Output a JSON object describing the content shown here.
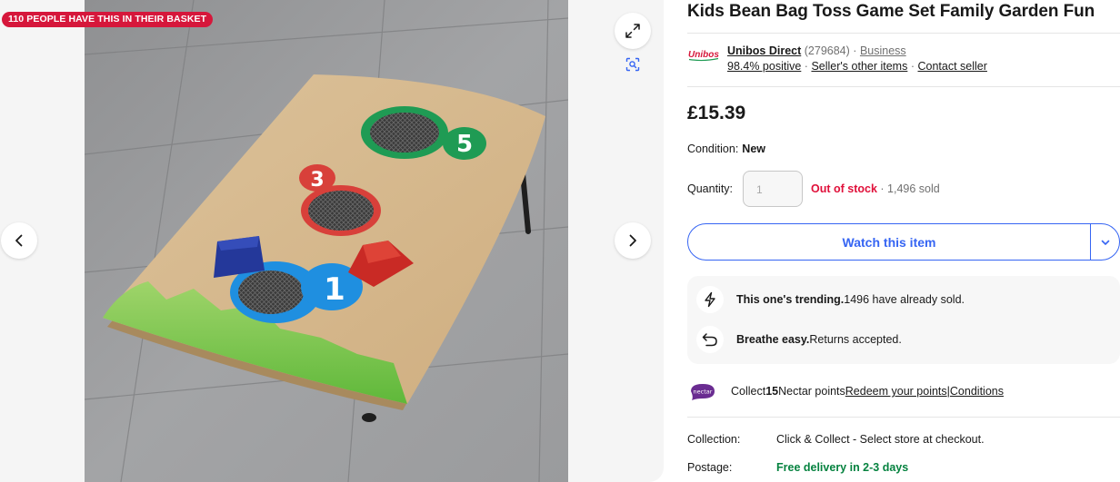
{
  "badge": "110 PEOPLE HAVE THIS IN THEIR BASKET",
  "icons": {
    "prev": "chevron-left-icon",
    "next": "chevron-right-icon",
    "expand": "expand-icon",
    "scan": "visual-search-icon",
    "dropdown": "chevron-down-icon",
    "trending": "lightning-icon",
    "returns": "return-arrow-icon"
  },
  "product": {
    "title": "Kids Bean Bag Toss Game Set Family Garden Fun",
    "price": "£15.39"
  },
  "seller": {
    "logo_text": "Unibos",
    "name": "Unibos Direct",
    "feedback_count": "(279684)",
    "sep1": "·",
    "type": "Business",
    "positive": "98.4% positive",
    "sep2": "·",
    "other_items": "Seller's other items",
    "sep3": "·",
    "contact": "Contact seller"
  },
  "condition": {
    "label": "Condition:",
    "value": "New"
  },
  "quantity": {
    "label": "Quantity:",
    "value": "1",
    "stock_status": "Out of stock",
    "sold": " · 1,496 sold"
  },
  "watch": {
    "label": "Watch this item"
  },
  "highlights": [
    {
      "bold": "This one's trending.",
      "text": " 1496 have already sold."
    },
    {
      "bold": "Breathe easy.",
      "text": " Returns accepted."
    }
  ],
  "nectar": {
    "logo_text": "nectar",
    "pre": "Collect ",
    "points": "15",
    "post": " Nectar points ",
    "redeem": "Redeem your points",
    "sep": " | ",
    "conditions": "Conditions"
  },
  "shipping": [
    {
      "label": "Collection:",
      "value": "Click & Collect - Select store at checkout."
    },
    {
      "label": "Postage:",
      "value": "Free delivery in 2-3 days"
    }
  ],
  "colors": {
    "accent": "#3665f3",
    "alert": "#e0103a",
    "badge": "#d6173b",
    "free_delivery": "#05823f",
    "nectar": "#6a2c91"
  }
}
